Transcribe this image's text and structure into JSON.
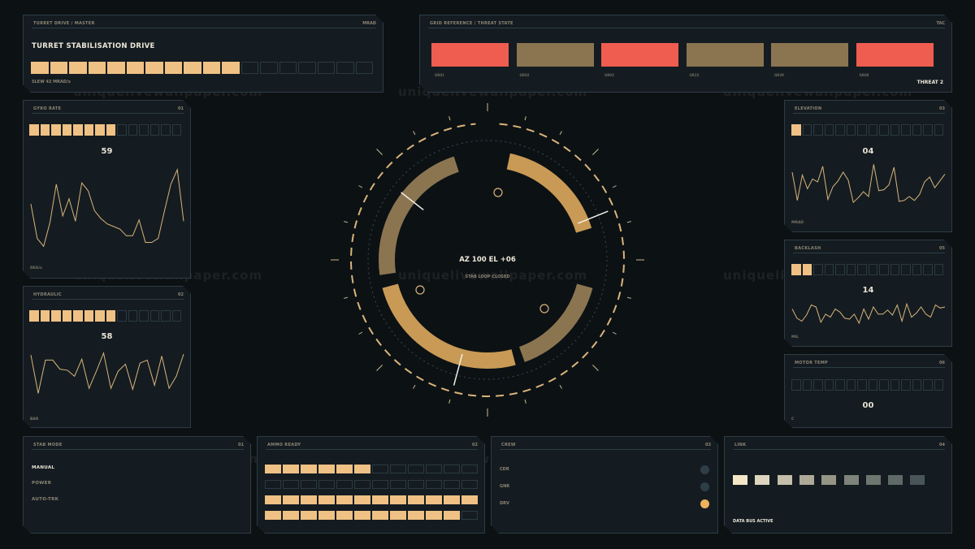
{
  "watermark": "uniquelivewallpaper.com",
  "colors": {
    "accent": "#efc184",
    "bronze": "#8b7551",
    "alert": "#ef5c50",
    "muted": "#8d8574",
    "track": "#2b3942"
  },
  "turret": {
    "title": "TURRET DRIVE / MASTER",
    "badge": "MRAD",
    "heading": "TURRET STABILISATION DRIVE",
    "level": 11,
    "total": 18,
    "footer": "SLEW 42 MRAD/s"
  },
  "grid": {
    "title": "GRID REFERENCE / THREAT STATE",
    "badge": "TAC",
    "status": "THREAT 2",
    "blocks": [
      {
        "label": "GR01",
        "state": "alert"
      },
      {
        "label": "GR02",
        "state": "nominal"
      },
      {
        "label": "GR03",
        "state": "alert"
      },
      {
        "label": "GR22",
        "state": "nominal"
      },
      {
        "label": "GR39",
        "state": "nominal"
      },
      {
        "label": "GR08",
        "state": "alert"
      }
    ]
  },
  "gyro": {
    "title": "GYRO RATE",
    "num": "01",
    "level": 8,
    "total": 14,
    "value": "59",
    "unit": "DEG/s",
    "series": [
      41,
      15,
      9,
      27,
      56,
      32,
      45,
      28,
      57,
      51,
      36,
      30,
      26,
      24,
      22,
      17,
      17,
      29,
      12,
      12,
      15,
      36,
      56,
      67,
      28
    ]
  },
  "hydraulic": {
    "title": "HYDRAULIC",
    "num": "02",
    "level": 8,
    "total": 14,
    "value": "58",
    "unit": "BAR",
    "series": [
      53,
      15,
      48,
      48,
      39,
      38,
      32,
      49,
      20,
      37,
      55,
      20,
      37,
      44,
      19,
      45,
      48,
      23,
      52,
      20,
      32,
      54
    ]
  },
  "elevation": {
    "title": "ELEVATION",
    "num": "03",
    "level": 1,
    "total": 14,
    "value": "04",
    "unit": "MRAD",
    "series": [
      40,
      11,
      37,
      23,
      33,
      30,
      46,
      12,
      25,
      31,
      40,
      32,
      9,
      14,
      20,
      15,
      48,
      21,
      22,
      27,
      45,
      10,
      11,
      15,
      11,
      17,
      30,
      35,
      24,
      31,
      38
    ]
  },
  "backlash": {
    "title": "BACKLASH",
    "num": "05",
    "level": 2,
    "total": 14,
    "value": "14",
    "unit": "MIL",
    "series": [
      18,
      9,
      6,
      12,
      22,
      20,
      5,
      13,
      10,
      18,
      15,
      9,
      8,
      13,
      4,
      18,
      8,
      20,
      13,
      13,
      17,
      12,
      22,
      6,
      23,
      10,
      14,
      20,
      13,
      10,
      22,
      19,
      20
    ]
  },
  "motor": {
    "title": "MOTOR TEMP",
    "num": "06",
    "level": 0,
    "total": 14,
    "value": "00",
    "unit": "C"
  },
  "reticle": {
    "readout": "AZ 100  EL +06",
    "status": "STAB LOOP CLOSED"
  },
  "stab": {
    "title": "STAB MODE",
    "num": "01",
    "items": [
      {
        "label": "MANUAL",
        "active": true
      },
      {
        "label": "POWER",
        "active": false
      },
      {
        "label": "AUTO-TRK",
        "active": false
      }
    ]
  },
  "ammo": {
    "title": "AMMO READY",
    "num": "02",
    "rows": [
      6,
      0,
      12,
      11
    ],
    "total": 12
  },
  "crew": {
    "title": "CREW",
    "num": "03",
    "members": [
      {
        "label": "CDR",
        "color": "#2e3e49"
      },
      {
        "label": "GNR",
        "color": "#2e3e49"
      },
      {
        "label": "DRV",
        "color": "#efb25c"
      }
    ]
  },
  "link": {
    "title": "LINK",
    "num": "04",
    "status": "DATA BUS ACTIVE",
    "swatches": [
      "#f5e6c8",
      "#ddd5c0",
      "#c4beab",
      "#adaa99",
      "#959586",
      "#7e8479",
      "#6d766f",
      "#5e6a67",
      "#4a5559"
    ]
  }
}
